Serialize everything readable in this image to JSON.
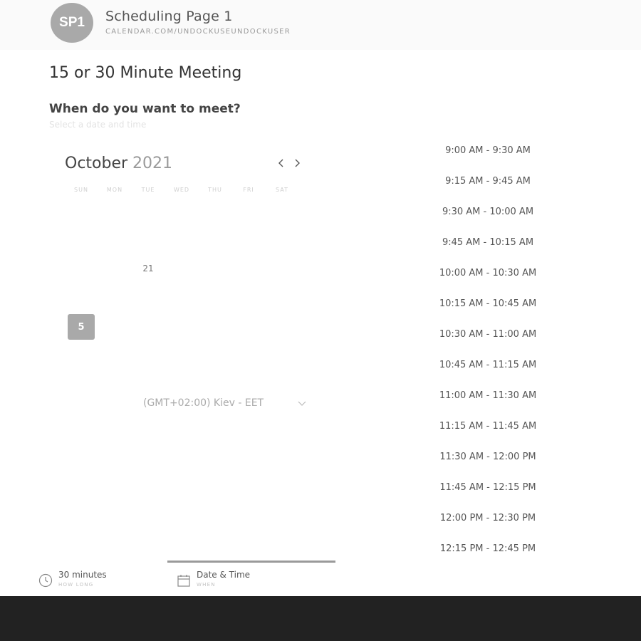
{
  "header": {
    "avatar_initials": "SP1",
    "title": "Scheduling Page 1",
    "url": "CALENDAR.COM/UNDOCKUSEUNDOCKUSER"
  },
  "meeting": {
    "title": "15 or 30 Minute Meeting",
    "question": "When do you want to meet?",
    "hint": "Select a date and time"
  },
  "calendar": {
    "month": "October",
    "year": "2021",
    "weekdays": [
      "SUN",
      "MON",
      "TUE",
      "WED",
      "THU",
      "FRI",
      "SAT"
    ],
    "visible_day": "21",
    "selected_day": "5"
  },
  "timezone": {
    "label": "(GMT+02:00) Kiev - EET"
  },
  "time_slots": [
    "9:00 AM - 9:30 AM",
    "9:15 AM - 9:45 AM",
    "9:30 AM - 10:00 AM",
    "9:45 AM - 10:15 AM",
    "10:00 AM - 10:30 AM",
    "10:15 AM - 10:45 AM",
    "10:30 AM - 11:00 AM",
    "10:45 AM - 11:15 AM",
    "11:00 AM - 11:30 AM",
    "11:15 AM - 11:45 AM",
    "11:30 AM - 12:00 PM",
    "11:45 AM - 12:15 PM",
    "12:00 PM - 12:30 PM",
    "12:15 PM - 12:45 PM"
  ],
  "steps": [
    {
      "label": "30 minutes",
      "sub": "HOW LONG",
      "icon": "clock-icon"
    },
    {
      "label": "Date & Time",
      "sub": "WHEN",
      "icon": "calendar-icon"
    }
  ],
  "colors": {
    "accent_gray": "#a9a9a9",
    "footer": "#222222"
  }
}
